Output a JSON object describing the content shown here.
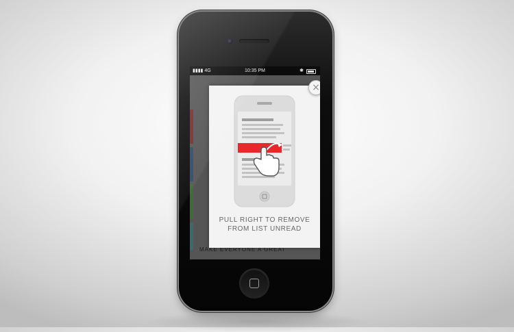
{
  "status_bar": {
    "carrier": "4G",
    "time": "10:35 PM"
  },
  "background_app": {
    "headline_fragment": "MAKE EVERYONE A GREAT"
  },
  "onboarding_tip": {
    "line1": "PULL RIGHT TO REMOVE",
    "line2": "FROM LIST UNREAD",
    "close_icon": "close-icon",
    "accent_color": "#e8282b"
  },
  "icons": {
    "signal": "signal-icon",
    "bluetooth": "bluetooth-icon",
    "battery": "battery-icon",
    "home": "home-button-icon"
  }
}
